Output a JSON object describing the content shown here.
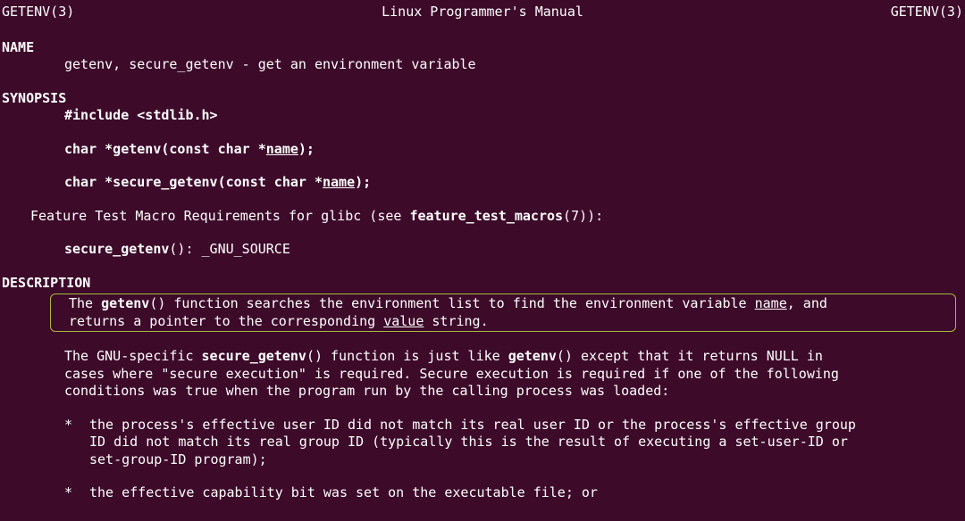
{
  "header": {
    "left": "GETENV(3)",
    "center": "Linux Programmer's Manual",
    "right": "GETENV(3)"
  },
  "sections": {
    "name": {
      "title": "NAME",
      "text": "getenv, secure_getenv - get an environment variable"
    },
    "synopsis": {
      "title": "SYNOPSIS",
      "include": "#include <stdlib.h>",
      "sig1_pre": "char *getenv(const char *",
      "sig1_param": "name",
      "sig1_post": ");",
      "sig2_pre": "char *secure_getenv(const char *",
      "sig2_param": "name",
      "sig2_post": ");",
      "feature_pre": "Feature Test Macro Requirements for glibc (see ",
      "feature_bold": "feature_test_macros",
      "feature_post": "(7)):",
      "secure_bold": "secure_getenv",
      "secure_post": "(): _GNU_SOURCE"
    },
    "description": {
      "title": "DESCRIPTION",
      "p1_part1": "The  ",
      "p1_bold1": "getenv",
      "p1_part2": "()  function  searches  the  environment list to find the environment variable ",
      "p1_underline1": "name",
      "p1_part3": ", and",
      "p1_line2_part1": "returns a pointer to the corresponding ",
      "p1_line2_underline": "value",
      "p1_line2_part2": " string.",
      "p2_part1": "The GNU-specific ",
      "p2_bold1": "secure_getenv",
      "p2_part2": "() function is just like ",
      "p2_bold2": "getenv",
      "p2_part3": "() except  that  it  returns  NULL  in",
      "p2_line2": "cases  where  \"secure execution\" is required.  Secure execution is required if one of the following",
      "p2_line3": "conditions was true when the program run by the calling process was loaded:",
      "bullet1_line1": "the process's effective user ID did not match its real user ID or the process's effective  group",
      "bullet1_line2": "ID  did  not match its real group ID (typically this is the result of executing a set-user-ID or",
      "bullet1_line3": "set-group-ID program);",
      "bullet2": "the effective capability bit was set on the executable file; or",
      "bullet_mark": "*"
    }
  }
}
